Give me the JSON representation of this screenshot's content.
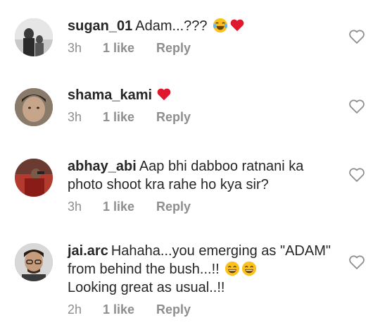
{
  "comments": [
    {
      "username": "sugan_01",
      "text": "Adam...???",
      "emojis": [
        "face-with-tears-of-joy",
        "red-heart"
      ],
      "time": "3h",
      "likes": "1 like",
      "reply_label": "Reply"
    },
    {
      "username": "shama_kami",
      "text": "",
      "emojis": [
        "red-heart"
      ],
      "time": "3h",
      "likes": "1 like",
      "reply_label": "Reply"
    },
    {
      "username": "abhay_abi",
      "text": "Aap bhi dabboo ratnani ka photo shoot kra rahe ho kya sir?",
      "emojis": [],
      "time": "3h",
      "likes": "1 like",
      "reply_label": "Reply"
    },
    {
      "username": "jai.arc",
      "text": "Hahaha...you emerging as \"ADAM\" from behind the bush...!!",
      "text2": "Looking great as usual..!!",
      "emojis": [
        "grinning-face-with-smiling-eyes",
        "grinning-face-with-smiling-eyes"
      ],
      "time": "2h",
      "likes": "1 like",
      "reply_label": "Reply"
    }
  ],
  "colors": {
    "username": "#262626",
    "meta": "#8e8e8e",
    "heart": "#ed4956",
    "outline_heart": "#8e8e8e"
  }
}
